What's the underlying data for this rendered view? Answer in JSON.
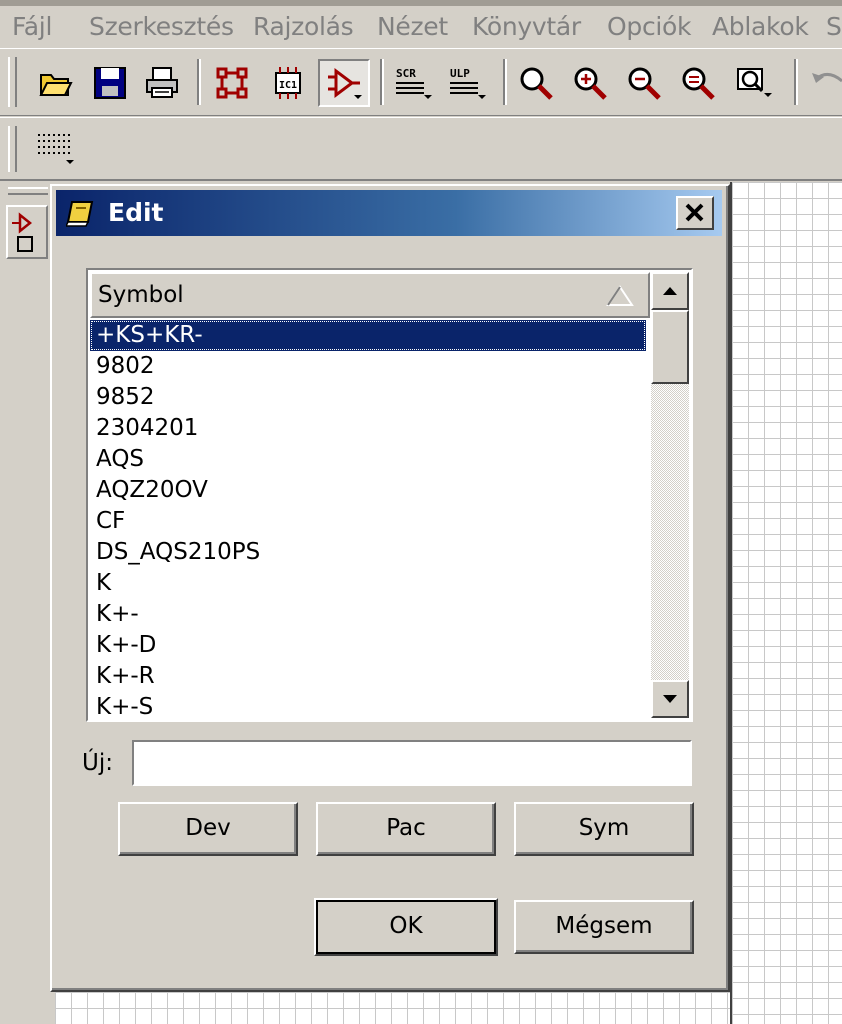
{
  "menu": {
    "items": [
      "Fájl",
      "Szerkesztés",
      "Rajzolás",
      "Nézet",
      "Könyvtár",
      "Opciók",
      "Ablakok",
      "S"
    ]
  },
  "toolbar": {
    "icons": [
      "open-folder-icon",
      "save-icon",
      "print-icon",
      "board-icon",
      "package-icon",
      "symbol-icon",
      "script-icon",
      "ulp-icon",
      "zoom-fit-icon",
      "zoom-in-icon",
      "zoom-out-icon",
      "zoom-redraw-icon",
      "zoom-select-icon",
      "undo-icon",
      "grid-icon"
    ]
  },
  "dialog": {
    "title": "Edit",
    "list": {
      "header": "Symbol",
      "items": [
        "+KS+KR-",
        "9802",
        "9852",
        "2304201",
        "AQS",
        "AQZ20OV",
        "CF",
        "DS_AQS210PS",
        "K",
        "K+-",
        "K+-D",
        "K+-R",
        "K+-S"
      ],
      "selected_index": 0
    },
    "new_label": "Új:",
    "new_value": "",
    "buttons": {
      "dev": "Dev",
      "pac": "Pac",
      "sym": "Sym",
      "ok": "OK",
      "cancel": "Mégsem"
    }
  },
  "colors": {
    "face": "#d4d0c8",
    "title_start": "#0a246a",
    "title_end": "#a6caf0",
    "selection": "#0a246a",
    "icon_red": "#a00000"
  }
}
